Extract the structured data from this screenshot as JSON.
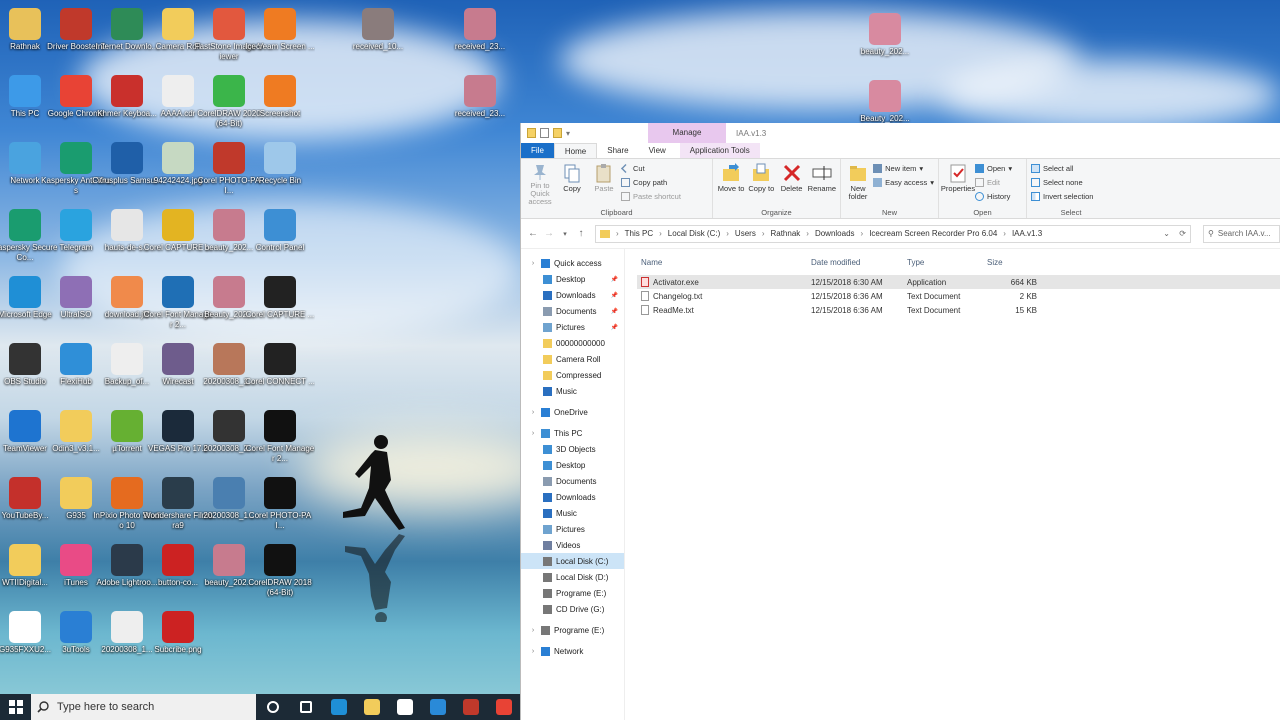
{
  "desktop": {
    "icons": [
      {
        "label": "Rathnak",
        "icon": "user-folder-icon",
        "color": "#e8c15a"
      },
      {
        "label": "Driver Booster 7",
        "icon": "driver-booster-icon",
        "color": "#c0392b"
      },
      {
        "label": "Internet Downlo...",
        "icon": "idm-icon",
        "color": "#2e8b57"
      },
      {
        "label": "Camera Roll",
        "icon": "folder-icon",
        "color": "#f2cc5b"
      },
      {
        "label": "FastStone Image Viewer",
        "icon": "faststone-icon",
        "color": "#e2583e"
      },
      {
        "label": "Icecream Screen ...",
        "icon": "icecream-icon",
        "color": "#ef7b22"
      },
      {
        "label": "This PC",
        "icon": "this-pc-icon",
        "color": "#3d9ae8"
      },
      {
        "label": "Google Chrome",
        "icon": "chrome-icon",
        "color": "#e84335"
      },
      {
        "label": "Khmer Keyboa...",
        "icon": "pdf-icon",
        "color": "#c9302c"
      },
      {
        "label": "AAAA.cdr",
        "icon": "cdr-file-icon",
        "color": "#eeeeee"
      },
      {
        "label": "CorelDRAW 2020 (64-Bit)",
        "icon": "coreldraw-icon",
        "color": "#3bb54a"
      },
      {
        "label": "Screenshot",
        "icon": "screenshot-icon",
        "color": "#ef7b22"
      },
      {
        "label": "Network",
        "icon": "network-icon",
        "color": "#4aa3df"
      },
      {
        "label": "Kaspersky Anti-Virus",
        "icon": "kaspersky-icon",
        "color": "#1a9c6f"
      },
      {
        "label": "Citrusplus Samsu...",
        "icon": "citrus-icon",
        "color": "#1f5fa8"
      },
      {
        "label": "94242424.jpg",
        "icon": "image-file-icon",
        "color": "#c6d9c2"
      },
      {
        "label": "Corel PHOTO-PAI...",
        "icon": "photo-paint-icon",
        "color": "#c0392b"
      },
      {
        "label": "Recycle Bin",
        "icon": "recycle-bin-icon",
        "color": "#9ec8ea"
      },
      {
        "label": "Kaspersky Secure Co...",
        "icon": "kaspersky-vpn-icon",
        "color": "#1a9c6f"
      },
      {
        "label": "Telegram",
        "icon": "telegram-icon",
        "color": "#2aa3df"
      },
      {
        "label": "hauts-de-s...",
        "icon": "file-icon",
        "color": "#e6e6e6"
      },
      {
        "label": "Corel CAPTURE ...",
        "icon": "corel-capture-icon",
        "color": "#e3b422"
      },
      {
        "label": "beauty_202...",
        "icon": "photo-icon",
        "color": "#c77b8e"
      },
      {
        "label": "Control Panel",
        "icon": "control-panel-icon",
        "color": "#3d8fd4"
      },
      {
        "label": "Microsoft Edge",
        "icon": "edge-icon",
        "color": "#1f8fd6"
      },
      {
        "label": "UltraISO",
        "icon": "disc-icon",
        "color": "#8e6fb5"
      },
      {
        "label": "download.jfif",
        "icon": "image-file-icon",
        "color": "#f08a4b"
      },
      {
        "label": "Corel Font Manager 2...",
        "icon": "font-manager-icon",
        "color": "#1f6fb5"
      },
      {
        "label": "Beauty_202...",
        "icon": "photo-icon",
        "color": "#c77b8e"
      },
      {
        "label": "Corel CAPTURE ...",
        "icon": "corel-capture-icon",
        "color": "#222222"
      },
      {
        "label": "OBS Studio",
        "icon": "obs-icon",
        "color": "#333333"
      },
      {
        "label": "FlexiHub",
        "icon": "flexihub-icon",
        "color": "#2f8fd8"
      },
      {
        "label": "Backup_of...",
        "icon": "cdr-file-icon",
        "color": "#eeeeee"
      },
      {
        "label": "Wirecast",
        "icon": "wirecast-icon",
        "color": "#6e5c8c"
      },
      {
        "label": "20200308_1...",
        "icon": "photo-icon",
        "color": "#b8775a"
      },
      {
        "label": "Corel CONNECT ...",
        "icon": "corel-connect-icon",
        "color": "#222222"
      },
      {
        "label": "TeamViewer",
        "icon": "teamviewer-icon",
        "color": "#1e74d0"
      },
      {
        "label": "Odin3_v3.1...",
        "icon": "folder-icon",
        "color": "#f2cc5b"
      },
      {
        "label": "µTorrent",
        "icon": "utorrent-icon",
        "color": "#66b032"
      },
      {
        "label": "VEGAS Pro 17.0",
        "icon": "vegas-icon",
        "color": "#1b2a3a"
      },
      {
        "label": "20200308_2...",
        "icon": "video-file-icon",
        "color": "#333333"
      },
      {
        "label": "Corel Font Manager 2...",
        "icon": "font-manager-icon",
        "color": "#111111"
      },
      {
        "label": "YouTubeBy...",
        "icon": "youtube-byclick-icon",
        "color": "#c4302b"
      },
      {
        "label": "G935",
        "icon": "folder-icon",
        "color": "#f2cc5b"
      },
      {
        "label": "InPixio Photo Studio 10",
        "icon": "inpixio-icon",
        "color": "#e56b1f"
      },
      {
        "label": "Wondershare Filmora9",
        "icon": "filmora-icon",
        "color": "#2a3d4b"
      },
      {
        "label": "20200308_1...",
        "icon": "photo-icon",
        "color": "#4a7fb0"
      },
      {
        "label": "Corel PHOTO-PAI...",
        "icon": "photo-paint-icon",
        "color": "#111111"
      },
      {
        "label": "WTIIDigital...",
        "icon": "folder-icon",
        "color": "#f2cc5b"
      },
      {
        "label": "iTunes",
        "icon": "itunes-icon",
        "color": "#e94b86"
      },
      {
        "label": "Adobe Lightroo...",
        "icon": "lightroom-icon",
        "color": "#2b3a4a"
      },
      {
        "label": "button-co...",
        "icon": "image-file-icon",
        "color": "#cc2222"
      },
      {
        "label": "beauty_202...",
        "icon": "photo-icon",
        "color": "#c77b8e"
      },
      {
        "label": "CorelDRAW 2018 (64-Bit)",
        "icon": "coreldraw-icon",
        "color": "#111111"
      },
      {
        "label": "G935FXXU2...",
        "icon": "file-icon",
        "color": "#ffffff"
      },
      {
        "label": "3uTools",
        "icon": "3utools-icon",
        "color": "#2a7fd4"
      },
      {
        "label": "20200308_1...",
        "icon": "cdr-file-icon",
        "color": "#eeeeee"
      },
      {
        "label": "Subcribe.png",
        "icon": "image-file-icon",
        "color": "#cc2222"
      },
      {
        "label": "received_10...",
        "icon": "photo-icon",
        "color": "#8a7c7c"
      },
      {
        "label": "received_23...",
        "icon": "photo-icon",
        "color": "#c77b8e"
      },
      {
        "label": "received_23...",
        "icon": "photo-icon",
        "color": "#c77b8e"
      },
      {
        "label": "beauty_202...",
        "icon": "photo-icon",
        "color": "#d88aa0"
      },
      {
        "label": "Beauty_202...",
        "icon": "photo-icon",
        "color": "#d88aa0"
      }
    ]
  },
  "taskbar": {
    "search_placeholder": "Type here to search",
    "pinned": [
      {
        "icon": "cortana-icon",
        "color": "#ffffff"
      },
      {
        "icon": "task-view-icon",
        "color": "#ffffff"
      },
      {
        "icon": "edge-taskbar-icon",
        "color": "#1f8fd6"
      },
      {
        "icon": "file-explorer-taskbar-icon",
        "color": "#f2cc5b"
      },
      {
        "icon": "store-taskbar-icon",
        "color": "#ffffff"
      },
      {
        "icon": "mail-taskbar-icon",
        "color": "#2a8ad8"
      },
      {
        "icon": "driver-booster-taskbar-icon",
        "color": "#c0392b"
      },
      {
        "icon": "chrome-taskbar-icon",
        "color": "#e84335"
      }
    ]
  },
  "explorer": {
    "window_title": "IAA.v1.3",
    "manage_label": "Manage",
    "tabs": {
      "file": "File",
      "home": "Home",
      "share": "Share",
      "view": "View",
      "app_tools": "Application Tools"
    },
    "ribbon": {
      "clipboard": {
        "pin": "Pin to Quick access",
        "copy": "Copy",
        "paste": "Paste",
        "cut": "Cut",
        "copy_path": "Copy path",
        "paste_shortcut": "Paste shortcut",
        "label": "Clipboard"
      },
      "organize": {
        "move_to": "Move to",
        "copy_to": "Copy to",
        "delete": "Delete",
        "rename": "Rename",
        "label": "Organize"
      },
      "new": {
        "new_folder": "New folder",
        "new_item": "New item",
        "easy_access": "Easy access",
        "label": "New"
      },
      "open": {
        "properties": "Properties",
        "open": "Open",
        "edit": "Edit",
        "history": "History",
        "label": "Open"
      },
      "select": {
        "select_all": "Select all",
        "select_none": "Select none",
        "invert": "Invert selection",
        "label": "Select"
      }
    },
    "breadcrumb": [
      "This PC",
      "Local Disk (C:)",
      "Users",
      "Rathnak",
      "Downloads",
      "Icecream Screen Recorder Pro 6.04",
      "IAA.v1.3"
    ],
    "search_placeholder": "Search IAA.v...",
    "nav": {
      "quick_access": "Quick access",
      "quick_items": [
        {
          "label": "Desktop",
          "pinned": true,
          "color": "#3d8fd4"
        },
        {
          "label": "Downloads",
          "pinned": true,
          "color": "#2a6fc0"
        },
        {
          "label": "Documents",
          "pinned": true,
          "color": "#8a9bb0"
        },
        {
          "label": "Pictures",
          "pinned": true,
          "color": "#6fa3cf"
        },
        {
          "label": "00000000000",
          "pinned": false,
          "color": "#f2cc5b"
        },
        {
          "label": "Camera Roll",
          "pinned": false,
          "color": "#f2cc5b"
        },
        {
          "label": "Compressed",
          "pinned": false,
          "color": "#f2cc5b"
        },
        {
          "label": "Music",
          "pinned": false,
          "color": "#2a6fc0"
        }
      ],
      "onedrive": "OneDrive",
      "this_pc": "This PC",
      "pc_items": [
        {
          "label": "3D Objects",
          "color": "#3d8fd4",
          "selected": false
        },
        {
          "label": "Desktop",
          "color": "#3d8fd4",
          "selected": false
        },
        {
          "label": "Documents",
          "color": "#8a9bb0",
          "selected": false
        },
        {
          "label": "Downloads",
          "color": "#2a6fc0",
          "selected": false
        },
        {
          "label": "Music",
          "color": "#2a6fc0",
          "selected": false
        },
        {
          "label": "Pictures",
          "color": "#6fa3cf",
          "selected": false
        },
        {
          "label": "Videos",
          "color": "#6f7fa0",
          "selected": false
        },
        {
          "label": "Local Disk (C:)",
          "color": "#777777",
          "selected": true
        },
        {
          "label": "Local Disk (D:)",
          "color": "#777777",
          "selected": false
        },
        {
          "label": "Programe (E:)",
          "color": "#777777",
          "selected": false
        },
        {
          "label": "CD Drive (G:)",
          "color": "#777777",
          "selected": false
        }
      ],
      "programe_drive": "Programe (E:)",
      "network": "Network"
    },
    "columns": {
      "name": "Name",
      "date": "Date modified",
      "type": "Type",
      "size": "Size"
    },
    "files": [
      {
        "name": "Activator.exe",
        "date": "12/15/2018 6:30 AM",
        "type": "Application",
        "size": "664 KB",
        "kind": "exe",
        "selected": true
      },
      {
        "name": "Changelog.txt",
        "date": "12/15/2018 6:36 AM",
        "type": "Text Document",
        "size": "2 KB",
        "kind": "txt",
        "selected": false
      },
      {
        "name": "ReadMe.txt",
        "date": "12/15/2018 6:36 AM",
        "type": "Text Document",
        "size": "15 KB",
        "kind": "txt",
        "selected": false
      }
    ]
  }
}
